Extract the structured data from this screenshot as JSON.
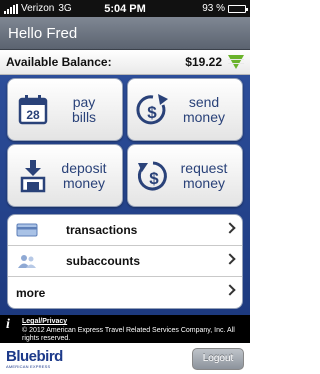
{
  "status_bar": {
    "carrier": "Verizon",
    "network": "3G",
    "time": "5:04 PM",
    "battery": "93 %",
    "battery_level": 0.93
  },
  "header": {
    "greeting": "Hello Fred"
  },
  "balance": {
    "label": "Available Balance:",
    "amount": "$19.22",
    "indicator_color": "#6ab32b"
  },
  "actions": [
    {
      "label": "pay\nbills",
      "icon": "calendar-icon"
    },
    {
      "label": "send\nmoney",
      "icon": "dollar-arrow-up-icon"
    },
    {
      "label": "deposit\nmoney",
      "icon": "deposit-icon"
    },
    {
      "label": "request\nmoney",
      "icon": "dollar-arrow-down-icon"
    }
  ],
  "menu": [
    {
      "label": "transactions",
      "icon": "card-icon"
    },
    {
      "label": "subaccounts",
      "icon": "people-icon"
    },
    {
      "label": "more",
      "icon": ""
    }
  ],
  "legal": {
    "title": "Legal/Privacy",
    "text": "© 2012 American Express Travel Related Services Company, Inc. All rights reserved."
  },
  "footer": {
    "logo": "Bluebird",
    "logo_byline": "AMERICAN EXPRESS",
    "logout_label": "Logout"
  },
  "colors": {
    "brand_blue": "#2d4e9a",
    "icon_blue": "#2a4279"
  }
}
